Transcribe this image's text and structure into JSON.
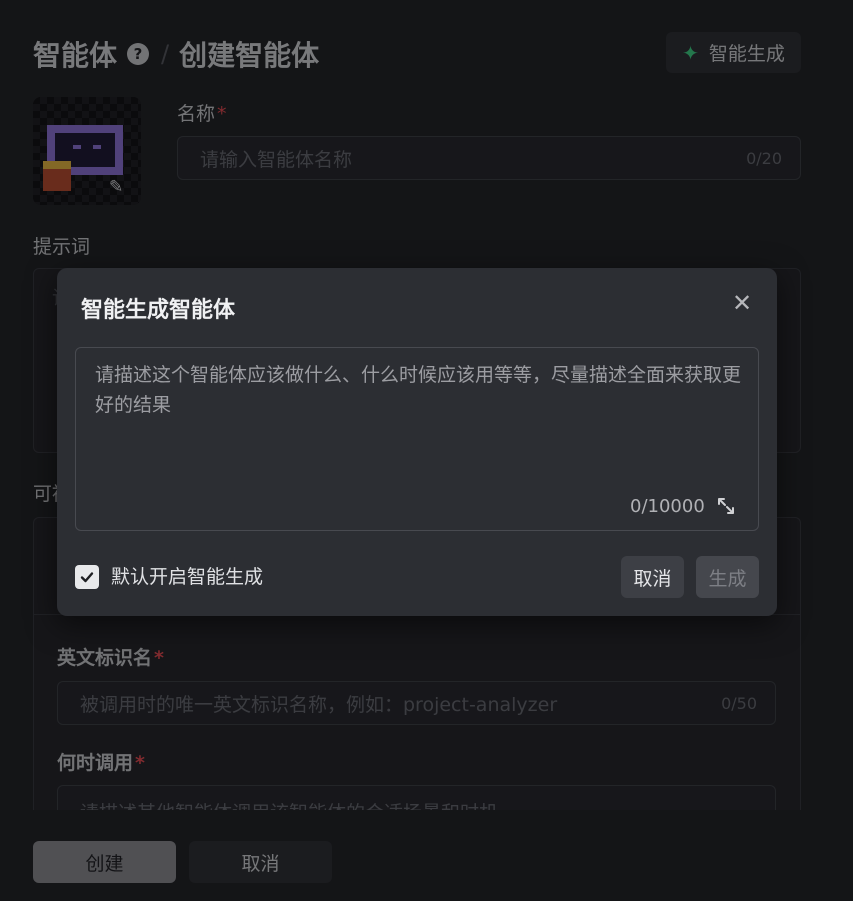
{
  "header": {
    "breadcrumb_root": "智能体",
    "help_icon": "question-circle-icon",
    "separator": "/",
    "breadcrumb_current": "创建智能体",
    "ai_generate_label": "智能生成",
    "ai_generate_icon": "sparkle-icon"
  },
  "form": {
    "name_label": "名称",
    "name_placeholder": "请输入智能体名称",
    "name_count": "0/20",
    "prompt_label": "提示词",
    "prompt_placeholder_fragment": "请",
    "section_label_fragment": "可被",
    "english_id_label": "英文标识名",
    "english_id_placeholder": "被调用时的唯一英文标识名称，例如：project-analyzer",
    "english_id_count": "0/50",
    "when_to_call_label": "何时调用",
    "when_to_call_placeholder": "请描述其他智能体调用该智能体的合适场景和时机",
    "required_mark": "*"
  },
  "footer": {
    "create_label": "创建",
    "cancel_label": "取消"
  },
  "modal": {
    "title": "智能生成智能体",
    "textarea_placeholder": "请描述这个智能体应该做什么、什么时候应该用等等，尽量描述全面来获取更好的结果",
    "textarea_count": "0/10000",
    "checkbox_label": "默认开启智能生成",
    "checkbox_checked": true,
    "cancel_label": "取消",
    "generate_label": "生成"
  },
  "colors": {
    "background": "#1e1f22",
    "modal_bg": "#2c2e33",
    "accent_green": "#3bd181",
    "required_red": "#e5484d"
  }
}
